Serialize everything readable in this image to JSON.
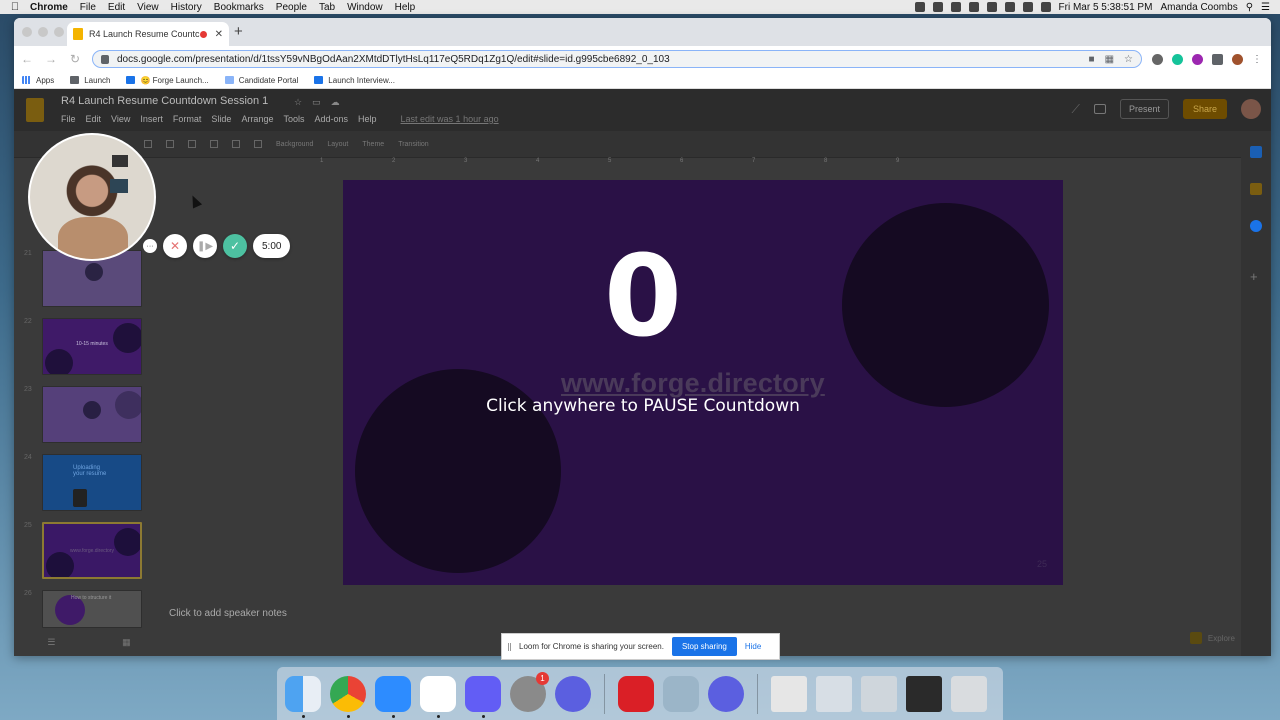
{
  "menubar": {
    "app": "Chrome",
    "items": [
      "File",
      "Edit",
      "View",
      "History",
      "Bookmarks",
      "People",
      "Tab",
      "Window",
      "Help"
    ],
    "clock": "Fri Mar 5  5:38:51 PM",
    "user": "Amanda Coombs"
  },
  "browser": {
    "tab_title": "R4 Launch Resume Countc",
    "url": "docs.google.com/presentation/d/1tssY59vNBgOdAan2XMtdDTlytHsLq117eQ5RDq1Zg1Q/edit#slide=id.g995cbe6892_0_103",
    "bookmarks": [
      "Apps",
      "Launch",
      "😊 Forge Launch...",
      "Candidate Portal",
      "Launch Interview..."
    ]
  },
  "slides_app": {
    "doc_title": "R4 Launch Resume Countdown Session 1",
    "menus": [
      "File",
      "Edit",
      "View",
      "Insert",
      "Format",
      "Slide",
      "Arrange",
      "Tools",
      "Add-ons",
      "Help"
    ],
    "last_edit": "Last edit was 1 hour ago",
    "present_label": "Present",
    "share_label": "Share",
    "toolbar": [
      "Background",
      "Layout",
      "Theme",
      "Transition"
    ],
    "ruler_ticks": [
      "1",
      "2",
      "3",
      "4",
      "5",
      "6",
      "7",
      "8",
      "9"
    ],
    "thumbnails": [
      {
        "num": "21",
        "text": ""
      },
      {
        "num": "22",
        "text": "10-15 minutes"
      },
      {
        "num": "23",
        "text": ""
      },
      {
        "num": "24",
        "text": "Uploading your resume"
      },
      {
        "num": "25",
        "text": "www.forge.directory"
      },
      {
        "num": "26",
        "text": "How to structure it"
      }
    ],
    "slide": {
      "countdown": "0",
      "website": "www.forge.directory",
      "pause_text": "Click anywhere to PAUSE Countdown",
      "page_number": "25"
    },
    "speaker_notes": "Click to add speaker notes",
    "explore": "Explore"
  },
  "loom": {
    "timer": "5:00",
    "more": "···"
  },
  "share_bar": {
    "message": "Loom for Chrome is sharing your screen.",
    "stop_label": "Stop sharing",
    "hide_label": "Hide"
  },
  "dock": {
    "apps": [
      "finder-icon",
      "chrome-icon",
      "zoom-icon",
      "slack-icon",
      "loom-icon",
      "system-preferences-icon",
      "loom-pinwheel-icon",
      "creative-cloud-icon",
      "preview-icon",
      "loom-pinwheel-icon",
      "file-icon",
      "window-thumb-icon",
      "window-thumb-icon",
      "window-thumb-icon",
      "trash-icon"
    ],
    "badge_count": "1"
  },
  "colors": {
    "slide_bg": "#2a1146",
    "loom_teal": "#4dc1a1",
    "stop_blue": "#1a73e8"
  }
}
